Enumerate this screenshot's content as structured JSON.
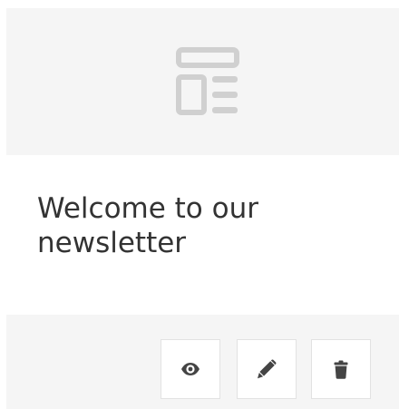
{
  "card": {
    "title": "Welcome to our newsletter",
    "thumbnail_icon": "newsletter-template-icon",
    "actions": [
      {
        "name": "preview",
        "icon": "eye-icon"
      },
      {
        "name": "edit",
        "icon": "pencil-icon"
      },
      {
        "name": "delete",
        "icon": "trash-icon"
      }
    ]
  },
  "colors": {
    "thumbnail_background": "#f5f5f5",
    "footer_background": "#f5f5f5",
    "card_background": "#ffffff",
    "title_text": "#333333",
    "icon_light_gray": "#d0d0d0",
    "icon_dark": "#444444",
    "button_border": "#e2e2e2"
  }
}
